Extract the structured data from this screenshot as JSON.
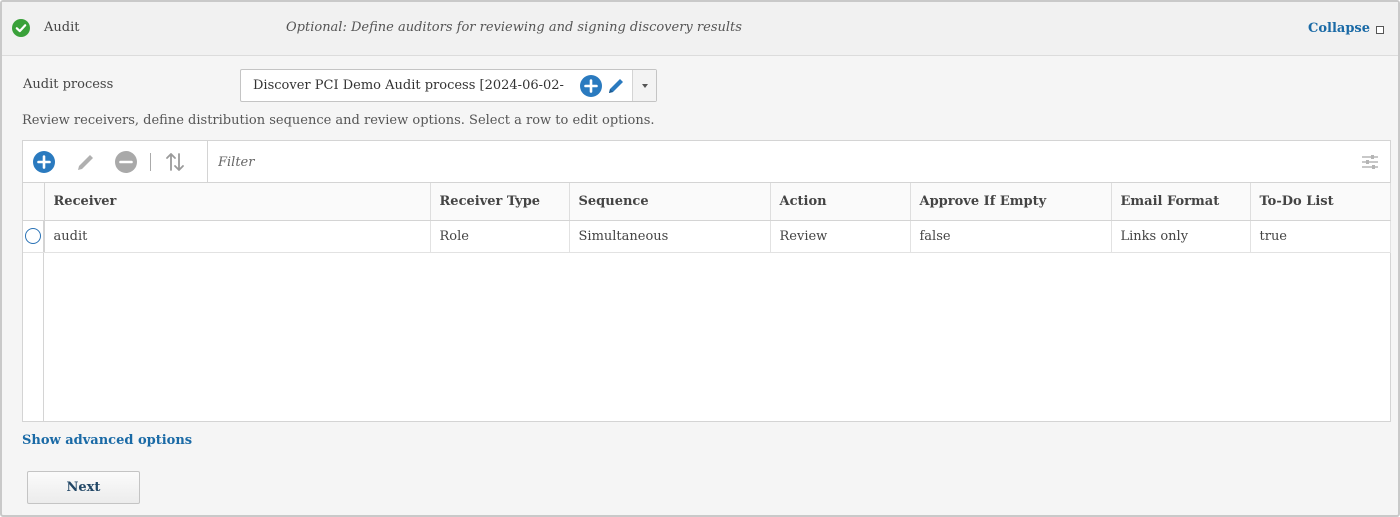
{
  "header": {
    "title": "Audit",
    "description": "Optional: Define auditors for reviewing and signing discovery results",
    "collapse_label": "Collapse",
    "status_color": "#3aa13a"
  },
  "audit_process": {
    "label": "Audit process",
    "selected_value": "Discover PCI Demo Audit process [2024-06-02-"
  },
  "instruction": "Review receivers, define distribution sequence and review options. Select a row to edit options.",
  "toolbar": {
    "filter_placeholder": "Filter",
    "icons": [
      "add-icon",
      "edit-icon",
      "remove-icon",
      "sort-icon",
      "columns-icon"
    ]
  },
  "table": {
    "columns": [
      "Receiver",
      "Receiver Type",
      "Sequence",
      "Action",
      "Approve If Empty",
      "Email Format",
      "To-Do List"
    ],
    "rows": [
      {
        "receiver": "audit",
        "receiver_type": "Role",
        "sequence": "Simultaneous",
        "action": "Review",
        "approve_if_empty": "false",
        "email_format": "Links only",
        "todo_list": "true"
      }
    ]
  },
  "advanced_options_label": "Show advanced options",
  "next_label": "Next",
  "colors": {
    "accent": "#1a6aa6",
    "primary_icon": "#2a7abf"
  }
}
